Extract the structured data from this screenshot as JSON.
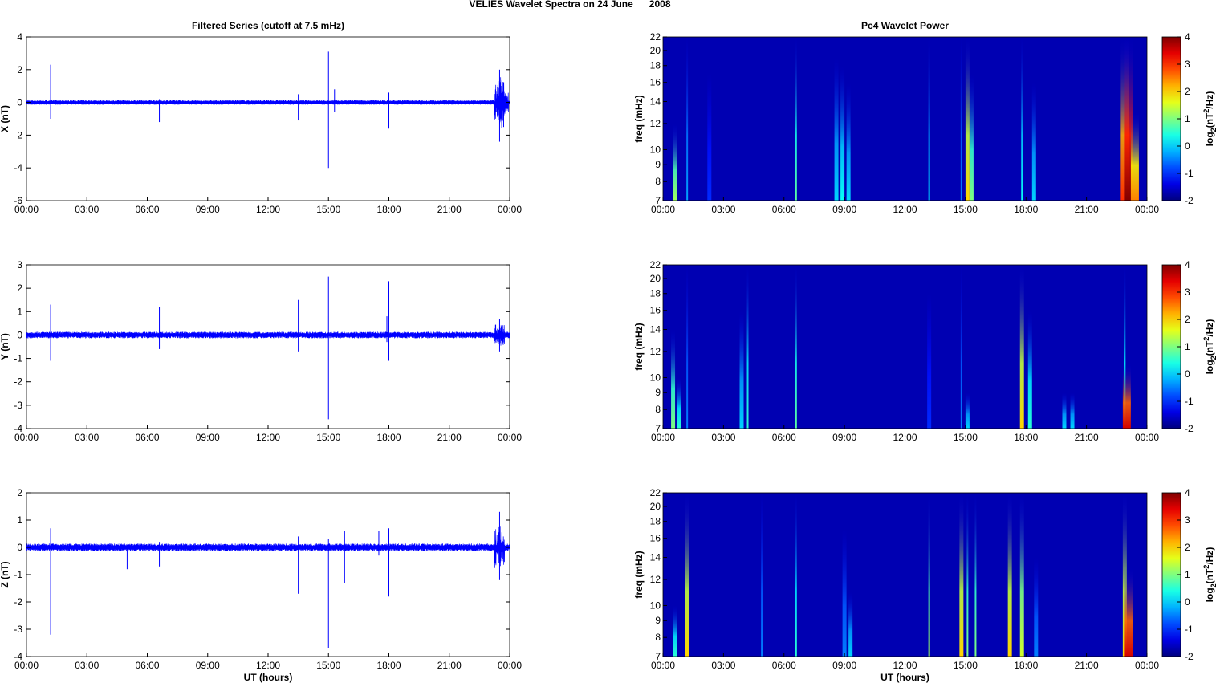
{
  "title": "VELIES Wavelet Spectra on 24 June      2008",
  "chart_data": [
    {
      "type": "line",
      "title": "Filtered Series (cutoff at 7.5 mHz)",
      "ylabel": "X (nT)",
      "xlabel": "",
      "ylim": [
        -6,
        4
      ],
      "yticks": [
        -6,
        -4,
        -2,
        0,
        2,
        4
      ],
      "xticks": [
        "00:00",
        "03:00",
        "06:00",
        "09:00",
        "12:00",
        "15:00",
        "18:00",
        "21:00",
        "00:00"
      ],
      "xlim_hours": [
        0,
        24
      ],
      "noise_amplitude": 0.1,
      "spikes": [
        {
          "t": 1.2,
          "max": 2.3,
          "min": -1.0
        },
        {
          "t": 6.6,
          "max": 0.2,
          "min": -1.2
        },
        {
          "t": 13.5,
          "max": 0.5,
          "min": -1.1
        },
        {
          "t": 15.0,
          "max": 3.1,
          "min": -4.0
        },
        {
          "t": 15.3,
          "max": 0.8,
          "min": -0.6
        },
        {
          "t": 18.0,
          "max": 0.6,
          "min": -1.6
        },
        {
          "t": 23.5,
          "max": 2.0,
          "min": -2.4
        },
        {
          "t": 23.7,
          "max": 1.2,
          "min": -1.5
        }
      ]
    },
    {
      "type": "heatmap",
      "title": "Pc4 Wavelet Power",
      "ylabel": "freq (mHz)",
      "yscale": "log",
      "ylim": [
        7,
        22
      ],
      "yticks": [
        7,
        8,
        9,
        10,
        12,
        14,
        16,
        18,
        20,
        22
      ],
      "xticks": [
        "00:00",
        "03:00",
        "06:00",
        "09:00",
        "12:00",
        "15:00",
        "18:00",
        "21:00",
        "00:00"
      ],
      "colorbar": {
        "label": "log2(nT^2/Hz)",
        "ticks": [
          -2,
          -1,
          0,
          1,
          2,
          3,
          4
        ],
        "clim": [
          -2,
          4
        ]
      },
      "events": [
        {
          "t": 0.6,
          "fmax": 12,
          "power": 1.2
        },
        {
          "t": 1.2,
          "fmax": 22,
          "power": -0.3
        },
        {
          "t": 2.3,
          "fmax": 17,
          "power": -1
        },
        {
          "t": 6.6,
          "fmax": 22,
          "power": 0.8
        },
        {
          "t": 8.6,
          "fmax": 19,
          "power": 0
        },
        {
          "t": 8.9,
          "fmax": 18,
          "power": 0.3
        },
        {
          "t": 9.2,
          "fmax": 16,
          "power": 0
        },
        {
          "t": 13.2,
          "fmax": 22,
          "power": 0
        },
        {
          "t": 14.8,
          "fmax": 22,
          "power": -0.5
        },
        {
          "t": 15.1,
          "fmax": 22,
          "power": 2
        },
        {
          "t": 15.3,
          "fmax": 17,
          "power": 1
        },
        {
          "t": 17.8,
          "fmax": 22,
          "power": 0.3
        },
        {
          "t": 18.4,
          "fmax": 16,
          "power": 0
        },
        {
          "t": 22.9,
          "fmax": 22,
          "power": 3
        },
        {
          "t": 23.1,
          "fmax": 22,
          "power": 4
        },
        {
          "t": 23.4,
          "fmax": 13,
          "power": 2.5
        }
      ]
    },
    {
      "type": "line",
      "title": "",
      "ylabel": "Y (nT)",
      "xlabel": "",
      "ylim": [
        -4,
        3
      ],
      "yticks": [
        -4,
        -3,
        -2,
        -1,
        0,
        1,
        2,
        3
      ],
      "xticks": [
        "00:00",
        "03:00",
        "06:00",
        "09:00",
        "12:00",
        "15:00",
        "18:00",
        "21:00",
        "00:00"
      ],
      "xlim_hours": [
        0,
        24
      ],
      "noise_amplitude": 0.1,
      "spikes": [
        {
          "t": 1.2,
          "max": 1.3,
          "min": -1.1
        },
        {
          "t": 6.6,
          "max": 1.2,
          "min": -0.6
        },
        {
          "t": 13.5,
          "max": 1.5,
          "min": -0.7
        },
        {
          "t": 15.0,
          "max": 2.5,
          "min": -3.6
        },
        {
          "t": 18.0,
          "max": 2.3,
          "min": -1.1
        },
        {
          "t": 17.9,
          "max": 0.8,
          "min": -0.3
        },
        {
          "t": 23.5,
          "max": 0.7,
          "min": -0.7
        }
      ]
    },
    {
      "type": "heatmap",
      "title": "",
      "ylabel": "freq (mHz)",
      "yscale": "log",
      "ylim": [
        7,
        22
      ],
      "yticks": [
        7,
        8,
        9,
        10,
        12,
        14,
        16,
        18,
        20,
        22
      ],
      "xticks": [
        "00:00",
        "03:00",
        "06:00",
        "09:00",
        "12:00",
        "15:00",
        "18:00",
        "21:00",
        "00:00"
      ],
      "colorbar": {
        "label": "log2(nT^2/Hz)",
        "ticks": [
          -2,
          -1,
          0,
          1,
          2,
          3,
          4
        ],
        "clim": [
          -2,
          4
        ]
      },
      "events": [
        {
          "t": 0.5,
          "fmax": 14,
          "power": 1
        },
        {
          "t": 0.8,
          "fmax": 10,
          "power": 0.5
        },
        {
          "t": 1.2,
          "fmax": 22,
          "power": -0.5
        },
        {
          "t": 3.9,
          "fmax": 16,
          "power": 0
        },
        {
          "t": 4.2,
          "fmax": 22,
          "power": 0.5
        },
        {
          "t": 6.6,
          "fmax": 22,
          "power": 0.8
        },
        {
          "t": 13.2,
          "fmax": 18,
          "power": -1
        },
        {
          "t": 14.8,
          "fmax": 22,
          "power": -0.5
        },
        {
          "t": 15.1,
          "fmax": 9,
          "power": 0
        },
        {
          "t": 17.8,
          "fmax": 22,
          "power": 2
        },
        {
          "t": 18.2,
          "fmax": 16,
          "power": 0.5
        },
        {
          "t": 19.9,
          "fmax": 9,
          "power": 0
        },
        {
          "t": 20.3,
          "fmax": 9,
          "power": 0
        },
        {
          "t": 22.9,
          "fmax": 22,
          "power": 0.5
        },
        {
          "t": 23.0,
          "fmax": 11,
          "power": 3.5
        }
      ]
    },
    {
      "type": "line",
      "title": "",
      "ylabel": "Z (nT)",
      "xlabel": "UT (hours)",
      "ylim": [
        -4,
        2
      ],
      "yticks": [
        -4,
        -3,
        -2,
        -1,
        0,
        1,
        2
      ],
      "xticks": [
        "00:00",
        "03:00",
        "06:00",
        "09:00",
        "12:00",
        "15:00",
        "18:00",
        "21:00",
        "00:00"
      ],
      "xlim_hours": [
        0,
        24
      ],
      "noise_amplitude": 0.1,
      "spikes": [
        {
          "t": 1.2,
          "max": 0.7,
          "min": -3.2
        },
        {
          "t": 5.0,
          "max": 0.1,
          "min": -0.8
        },
        {
          "t": 6.6,
          "max": 0.2,
          "min": -0.7
        },
        {
          "t": 13.5,
          "max": 0.4,
          "min": -1.7
        },
        {
          "t": 15.0,
          "max": 0.3,
          "min": -3.7
        },
        {
          "t": 15.8,
          "max": 0.6,
          "min": -1.3
        },
        {
          "t": 17.5,
          "max": 0.6,
          "min": -0.3
        },
        {
          "t": 18.0,
          "max": 0.7,
          "min": -1.8
        },
        {
          "t": 23.5,
          "max": 1.3,
          "min": -1.2
        }
      ]
    },
    {
      "type": "heatmap",
      "title": "",
      "ylabel": "freq (mHz)",
      "xlabel": "UT (hours)",
      "yscale": "log",
      "ylim": [
        7,
        22
      ],
      "yticks": [
        7,
        8,
        9,
        10,
        12,
        14,
        16,
        18,
        20,
        22
      ],
      "xticks": [
        "00:00",
        "03:00",
        "06:00",
        "09:00",
        "12:00",
        "15:00",
        "18:00",
        "21:00",
        "00:00"
      ],
      "colorbar": {
        "label": "log2(nT^2/Hz)",
        "ticks": [
          -2,
          -1,
          0,
          1,
          2,
          3,
          4
        ],
        "clim": [
          -2,
          4
        ]
      },
      "events": [
        {
          "t": 0.6,
          "fmax": 10,
          "power": 0.5
        },
        {
          "t": 1.2,
          "fmax": 22,
          "power": 2
        },
        {
          "t": 4.9,
          "fmax": 22,
          "power": -0.5
        },
        {
          "t": 6.6,
          "fmax": 22,
          "power": 0.5
        },
        {
          "t": 9.0,
          "fmax": 17,
          "power": -0.5
        },
        {
          "t": 9.3,
          "fmax": 11,
          "power": 0
        },
        {
          "t": 13.2,
          "fmax": 22,
          "power": 1.2
        },
        {
          "t": 14.8,
          "fmax": 22,
          "power": 2
        },
        {
          "t": 15.1,
          "fmax": 22,
          "power": 1
        },
        {
          "t": 15.5,
          "fmax": 22,
          "power": 1
        },
        {
          "t": 17.2,
          "fmax": 22,
          "power": 2
        },
        {
          "t": 17.8,
          "fmax": 22,
          "power": 1.5
        },
        {
          "t": 18.5,
          "fmax": 14,
          "power": -0.5
        },
        {
          "t": 22.9,
          "fmax": 22,
          "power": 2
        },
        {
          "t": 23.1,
          "fmax": 13,
          "power": 3.5
        }
      ]
    }
  ]
}
